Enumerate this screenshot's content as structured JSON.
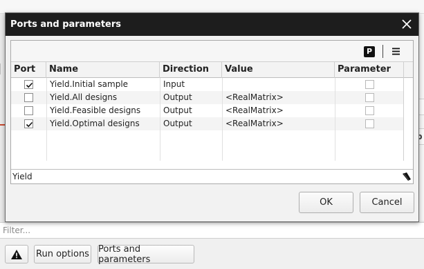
{
  "dialog": {
    "title": "Ports and parameters",
    "toolbar": {
      "p_label": "P"
    },
    "columns": [
      "Port",
      "Name",
      "Direction",
      "Value",
      "Parameter"
    ],
    "rows": [
      {
        "port": true,
        "name": "Yield.Initial sample",
        "direction": "Input",
        "value": "",
        "parameter": false
      },
      {
        "port": false,
        "name": "Yield.All designs",
        "direction": "Output",
        "value": "<RealMatrix>",
        "parameter": false
      },
      {
        "port": false,
        "name": "Yield.Feasible designs",
        "direction": "Output",
        "value": "<RealMatrix>",
        "parameter": false
      },
      {
        "port": true,
        "name": "Yield.Optimal designs",
        "direction": "Output",
        "value": "<RealMatrix>",
        "parameter": false
      }
    ],
    "filter_value": "Yield",
    "ok_label": "OK",
    "cancel_label": "Cancel"
  },
  "background": {
    "filter_placeholder": "Filter...",
    "run_options_label": "Run options",
    "ports_and_parameters_label": "Ports and parameters",
    "edge_glyph": "b"
  },
  "colors": {
    "titlebar": "#1d1d1d",
    "warning": "#111111"
  }
}
